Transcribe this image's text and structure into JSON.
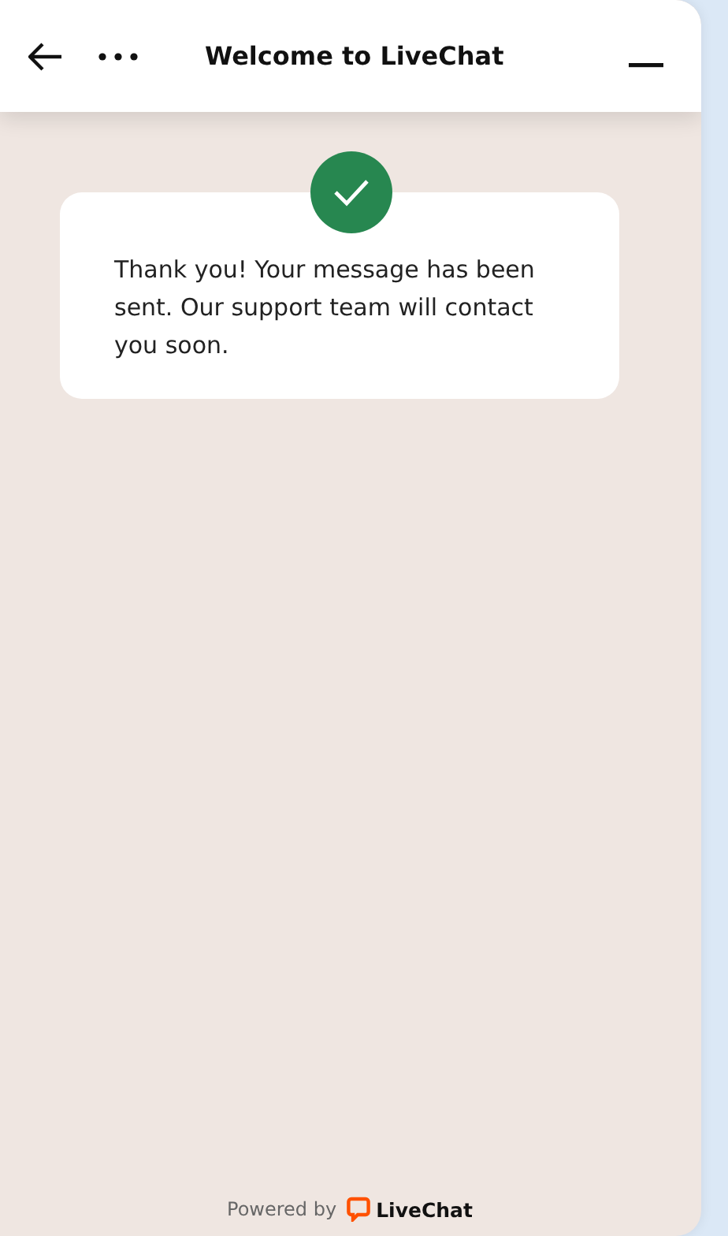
{
  "header": {
    "title": "Welcome to LiveChat"
  },
  "message": {
    "text": "Thank you! Your message has been sent. Our support team will contact you soon."
  },
  "footer": {
    "powered_by": "Powered by",
    "brand": "LiveChat"
  }
}
